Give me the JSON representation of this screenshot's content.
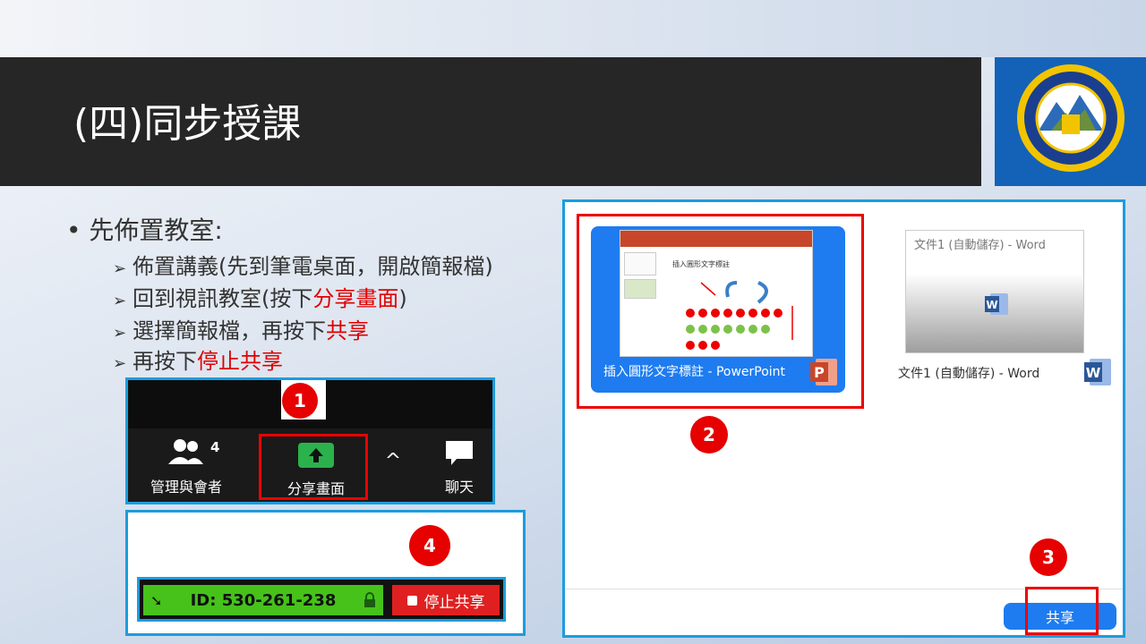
{
  "slide": {
    "title": "(四)同步授課",
    "bullet": "先佈置教室:",
    "steps": [
      {
        "pre": "佈置講義(先到筆電桌面，開啟簡報檔)",
        "red": "",
        "post": ""
      },
      {
        "pre": "回到視訊教室(按下",
        "red": "分享畫面",
        "post": ")"
      },
      {
        "pre": "選擇簡報檔，再按下",
        "red": "共享",
        "post": ""
      },
      {
        "pre": "再按下",
        "red": "停止共享",
        "post": ""
      }
    ],
    "arrow_glyph": "➢"
  },
  "toolbar": {
    "participants_label": "管理與會者",
    "participants_count": "4",
    "share_label": "分享畫面",
    "chat_label": "聊天",
    "caret": "^"
  },
  "stop_panel": {
    "meeting_id": "ID: 530-261-238",
    "stop_label": "停止共享"
  },
  "share_dialog": {
    "ppt_window_label": "插入圓形文字標註 - PowerPoint",
    "ppt_slide_text": "插入圓形文字標註",
    "word_window_title": "文件1 (自動儲存) - Word",
    "word_window_label": "文件1 (自動儲存) - Word",
    "share_button": "共享"
  },
  "callouts": [
    "1",
    "2",
    "3",
    "4"
  ],
  "colors": {
    "accent": "#1c9cde",
    "red": "#e00000",
    "blue_card": "#1e7cf0",
    "green": "#46c21b"
  }
}
